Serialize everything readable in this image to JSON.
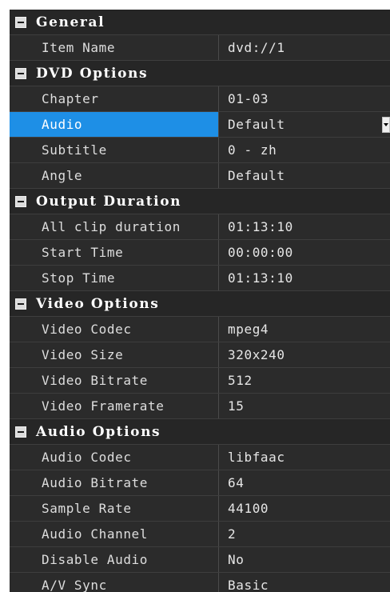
{
  "categories": [
    {
      "title": "General",
      "rows": [
        {
          "name": "Item Name",
          "value": "dvd://1"
        }
      ]
    },
    {
      "title": "DVD Options",
      "rows": [
        {
          "name": "Chapter",
          "value": "01-03"
        },
        {
          "name": "Audio",
          "value": "Default",
          "selected": true,
          "dropdown": true
        },
        {
          "name": "Subtitle",
          "value": "0 - zh"
        },
        {
          "name": "Angle",
          "value": "Default"
        }
      ]
    },
    {
      "title": "Output Duration",
      "rows": [
        {
          "name": "All clip duration",
          "value": "01:13:10"
        },
        {
          "name": "Start Time",
          "value": "00:00:00"
        },
        {
          "name": "Stop Time",
          "value": "01:13:10"
        }
      ]
    },
    {
      "title": "Video Options",
      "rows": [
        {
          "name": "Video Codec",
          "value": "mpeg4"
        },
        {
          "name": "Video Size",
          "value": "320x240"
        },
        {
          "name": "Video Bitrate",
          "value": "512"
        },
        {
          "name": "Video Framerate",
          "value": "15"
        }
      ]
    },
    {
      "title": "Audio Options",
      "rows": [
        {
          "name": "Audio Codec",
          "value": "libfaac"
        },
        {
          "name": "Audio Bitrate",
          "value": "64"
        },
        {
          "name": "Sample Rate",
          "value": "44100"
        },
        {
          "name": "Audio Channel",
          "value": "2"
        },
        {
          "name": "Disable Audio",
          "value": "No"
        },
        {
          "name": "A/V Sync",
          "value": "Basic"
        }
      ]
    }
  ],
  "icons": {
    "collapse": "collapse-minus-icon",
    "dropdown": "dropdown-arrow-icon"
  },
  "colors": {
    "background": "#2b2b2b",
    "selection": "#1e8fe6",
    "text": "#e6e6e6"
  }
}
